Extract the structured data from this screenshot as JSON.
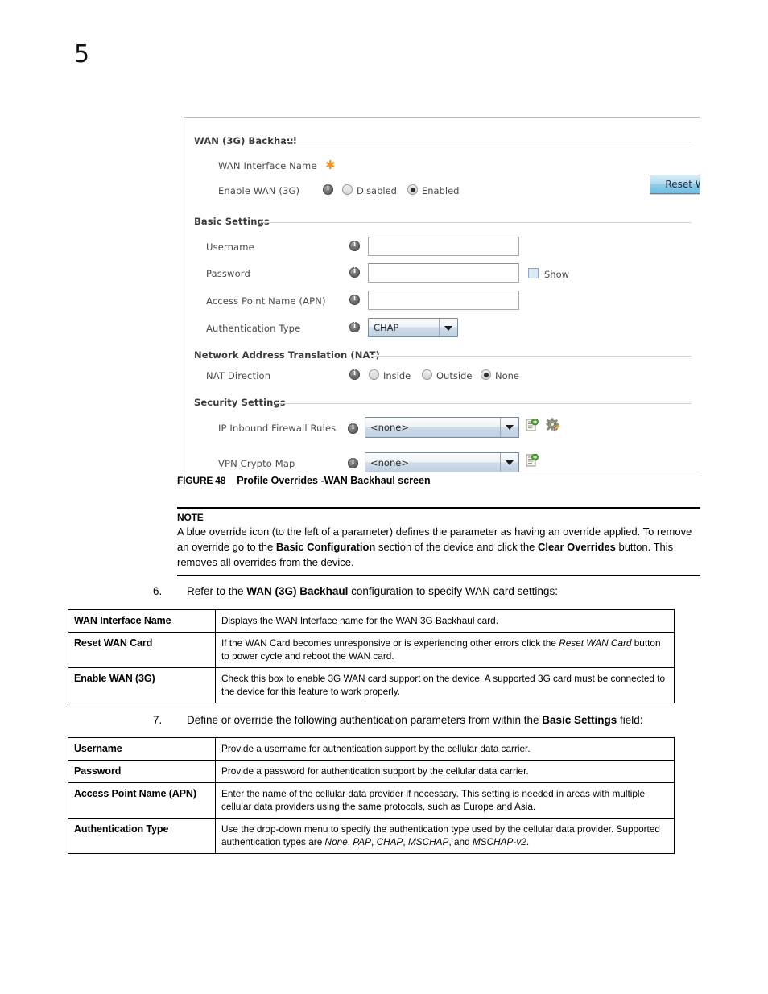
{
  "page": {
    "number": "5"
  },
  "figure": {
    "number": "FIGURE 48",
    "title": "Profile Overrides -WAN Backhaul screen"
  },
  "screenshot": {
    "sections": {
      "wan_backhaul": "WAN (3G) Backhaul",
      "basic_settings": "Basic Settings",
      "nat": "Network Address Translation (NAT)",
      "security_settings": "Security Settings"
    },
    "fields": {
      "wan_interface_name": "WAN Interface Name",
      "enable_wan": "Enable WAN (3G)",
      "username": "Username",
      "password": "Password",
      "apn": "Access Point Name (APN)",
      "auth_type": "Authentication Type",
      "nat_direction": "NAT Direction",
      "ip_inbound_firewall_rules": "IP Inbound Firewall Rules",
      "vpn_crypto_map": "VPN Crypto Map"
    },
    "values": {
      "username": "",
      "password": "",
      "apn": "",
      "auth_type": "CHAP",
      "ip_inbound_firewall_rules": "<none>",
      "vpn_crypto_map": "<none>"
    },
    "radios": {
      "enable_wan": [
        {
          "label": "Disabled",
          "selected": false
        },
        {
          "label": "Enabled",
          "selected": true
        }
      ],
      "nat_direction": [
        {
          "label": "Inside",
          "selected": false
        },
        {
          "label": "Outside",
          "selected": false
        },
        {
          "label": "None",
          "selected": true
        }
      ]
    },
    "checkboxes": {
      "show_password": {
        "label": "Show",
        "checked": false
      }
    },
    "buttons": {
      "reset_wan_card": "Reset W"
    },
    "colors": {
      "required_star": "#f2941b",
      "combo_fill": "#bed0e2",
      "button_fill": "#8ecbe9",
      "checkbox_fill": "#dce9f5"
    }
  },
  "note": {
    "title": "NOTE",
    "line1_a": "A blue override icon (to the left of a parameter) defines the parameter as having an override applied.",
    "line2_a": "To remove an override go to the ",
    "line2_b": "Basic Configuration",
    "line2_c": " section of the device and click the ",
    "line2_d": "Clear",
    "line3_a": "Overrides",
    "line3_b": " button. This removes all overrides from the device."
  },
  "steps": [
    {
      "number": "6.",
      "pre": "Refer to the ",
      "bold": "WAN (3G) Backhaul",
      "post": " configuration to specify WAN card settings:"
    },
    {
      "number": "7.",
      "pre": "Define or override the following authentication parameters from within the ",
      "bold": "Basic Settings",
      "post": " field:"
    }
  ],
  "table_wan": [
    {
      "term": "WAN Interface Name",
      "defn": "Displays the WAN Interface name for the WAN 3G Backhaul card."
    },
    {
      "term": "Reset WAN Card",
      "defn_pre": "If the WAN Card becomes unresponsive or is experiencing other errors click the ",
      "defn_em": "Reset WAN Card",
      "defn_post": " button to power cycle and reboot the WAN card."
    },
    {
      "term": "Enable WAN (3G)",
      "defn": "Check this box to enable 3G WAN card support on the device. A supported 3G card must be connected to the device for this feature to work properly."
    }
  ],
  "table_basic": [
    {
      "term": "Username",
      "defn": "Provide a username for authentication support by the cellular data carrier."
    },
    {
      "term": "Password",
      "defn": "Provide a password for authentication support by the cellular data carrier."
    },
    {
      "term": "Access Point Name (APN)",
      "defn": "Enter the name of the cellular data provider if necessary. This setting is needed in areas with multiple cellular data providers using the same protocols, such as Europe and Asia."
    },
    {
      "term": "Authentication Type",
      "defn_pre": "Use the drop-down menu to specify the authentication type used by the cellular data provider. Supported authentication types are ",
      "defn_em1": "None",
      "defn_mid1": ", ",
      "defn_em2": "PAP",
      "defn_mid2": ", ",
      "defn_em3": "CHAP",
      "defn_mid3": ", ",
      "defn_em4": "MSCHAP",
      "defn_mid4": ", and ",
      "defn_em5": "MSCHAP-v2",
      "defn_post": "."
    }
  ]
}
